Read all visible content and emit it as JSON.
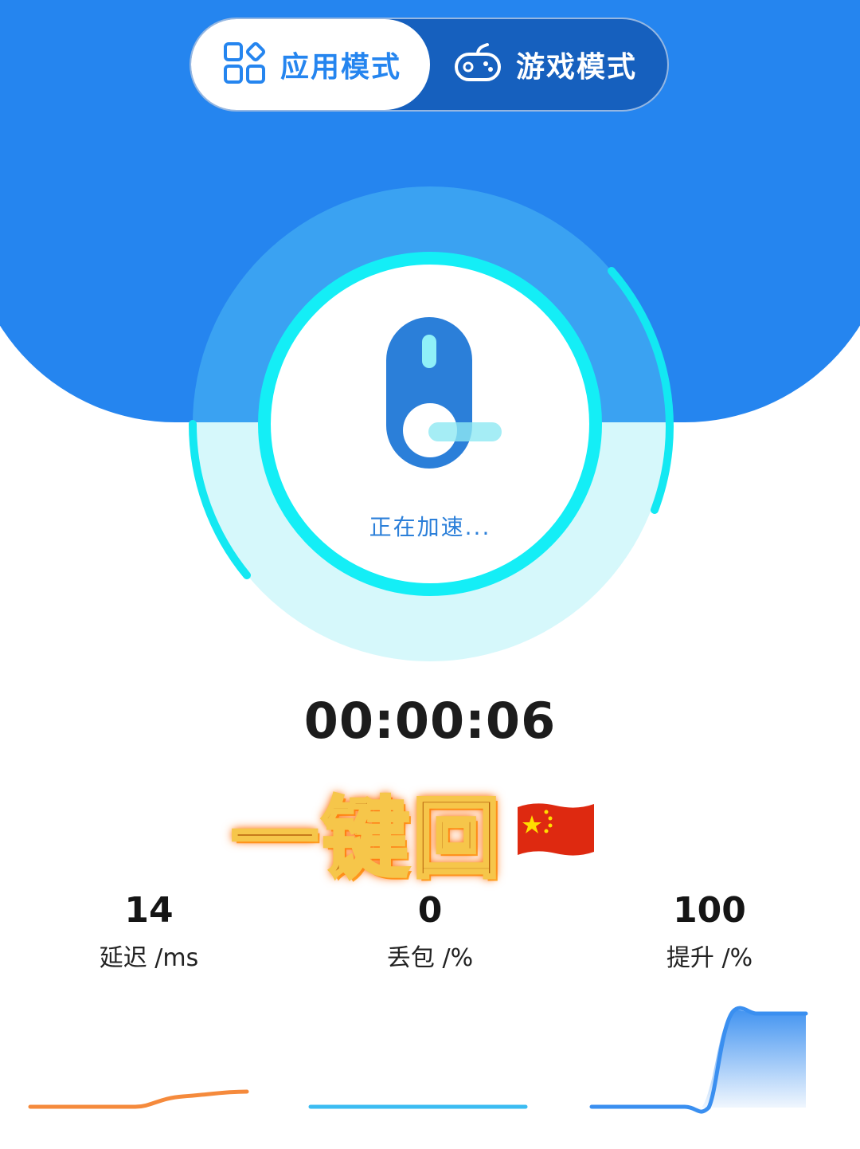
{
  "mode_toggle": {
    "app_mode_label": "应用模式",
    "game_mode_label": "游戏模式",
    "selected": "app"
  },
  "accelerator": {
    "status_text": "正在加速...",
    "timer": "00:00:06"
  },
  "banner": {
    "text": "一键回",
    "flag_icon": "china-flag"
  },
  "stats": [
    {
      "value": "14",
      "label": "延迟 /ms",
      "color": "#f58a3c"
    },
    {
      "value": "0",
      "label": "丢包 /%",
      "color": "#3bbcf2"
    },
    {
      "value": "100",
      "label": "提升 /%",
      "color": "#3a8ff0"
    }
  ],
  "colors": {
    "primary_blue": "#2585ef",
    "cyan_ring": "#12e6f2"
  }
}
